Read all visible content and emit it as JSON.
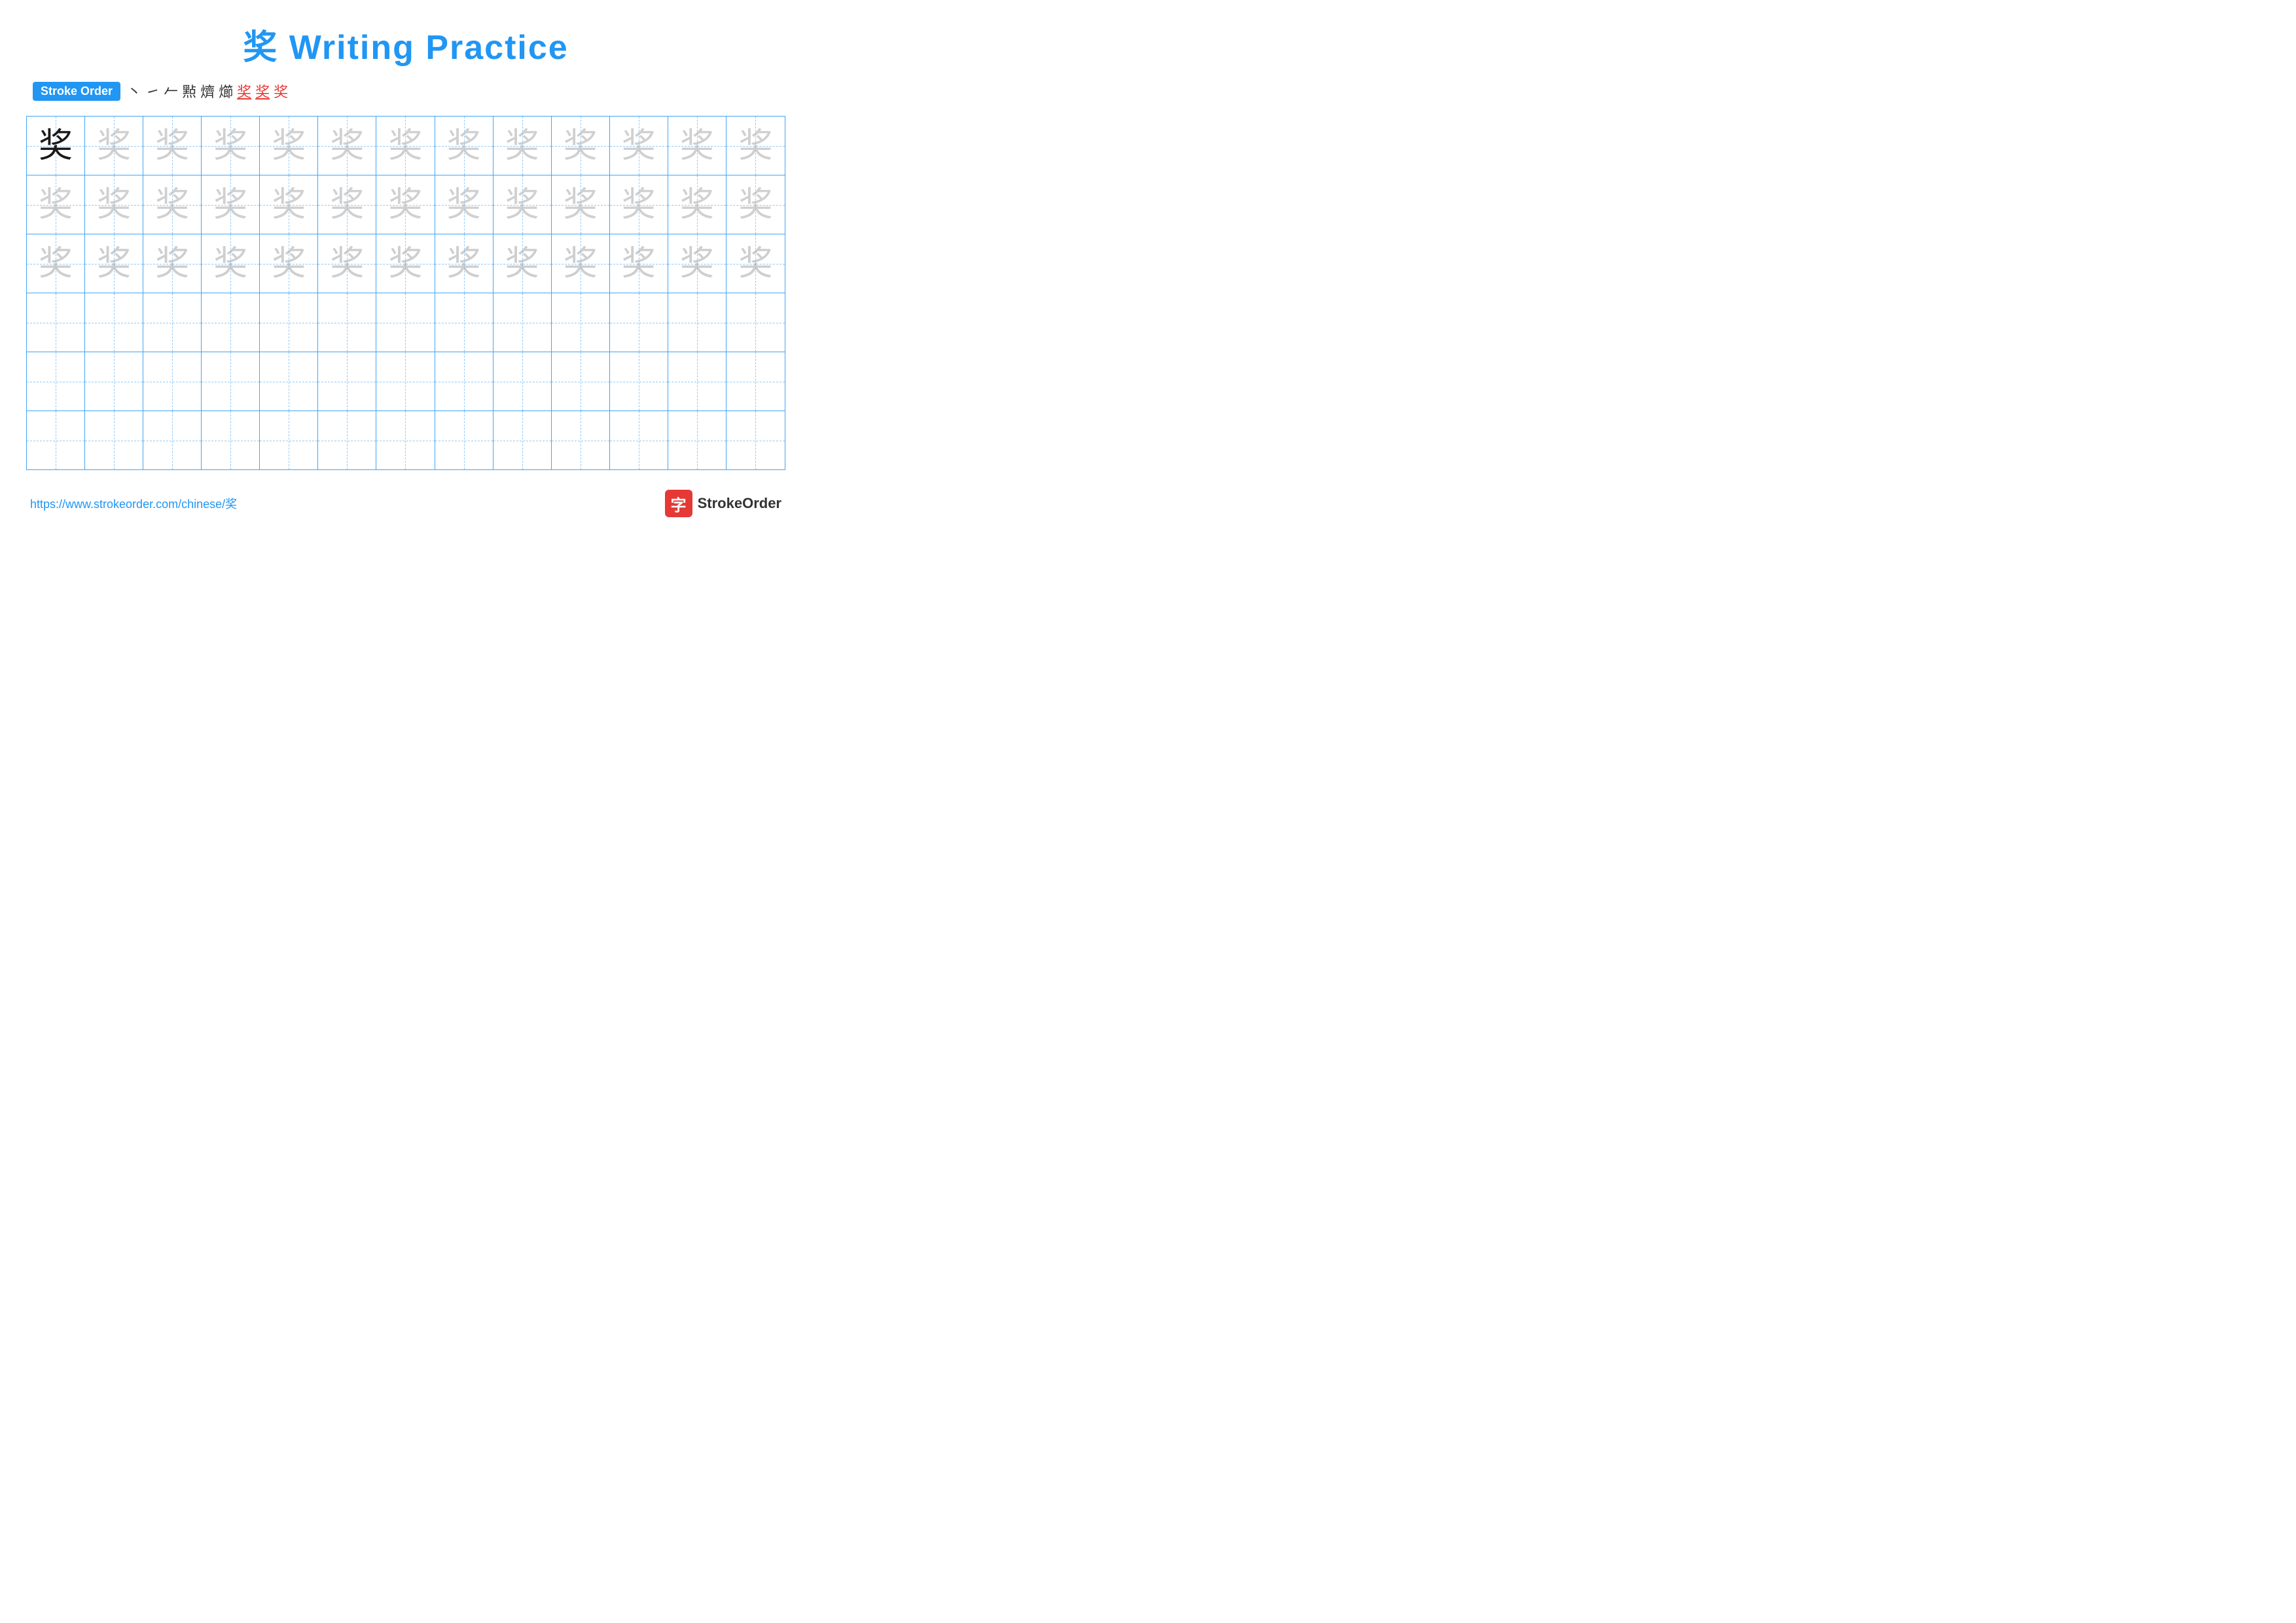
{
  "title": "奖 Writing Practice",
  "stroke_order": {
    "label": "Stroke Order",
    "steps": [
      "丶",
      "㇀",
      "小",
      "小",
      "㸃",
      "㸃",
      "奖",
      "奖",
      "奖"
    ],
    "red_indices": [
      6,
      7,
      8
    ]
  },
  "character": "奖",
  "grid": {
    "cols": 13,
    "rows": 6,
    "practice_rows": 3,
    "empty_rows": 3
  },
  "footer": {
    "url": "https://www.strokeorder.com/chinese/奖",
    "brand": "StrokeOrder"
  }
}
